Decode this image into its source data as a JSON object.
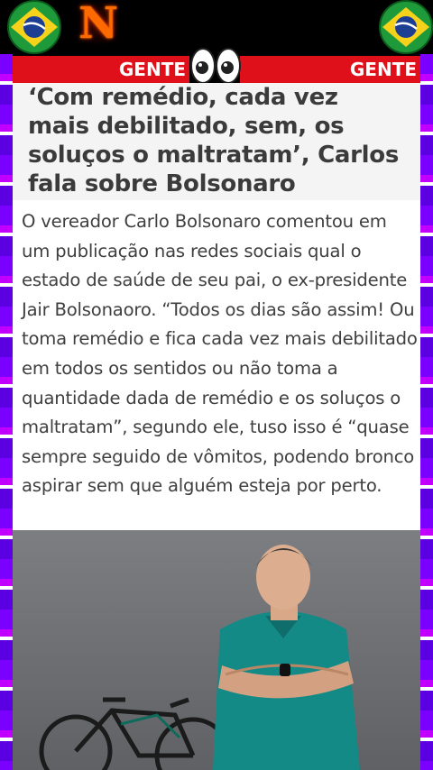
{
  "header": {
    "logo_letter": "N",
    "ticker_left": "GENTE",
    "ticker_right": "GENTE"
  },
  "article": {
    "headline": "‘Com remédio, cada vez mais debilitado, sem, os soluços o maltratam’, Carlos fala sobre Bolsonaro",
    "body": "O vereador Carlo Bolsonaro comentou em um publicação nas redes sociais qual o estado de saúde de seu pai, o ex-presidente Jair Bolsonaoro. “Todos os dias são assim! Ou toma remédio e fica cada vez mais debilitado em todos os sentidos ou não toma a quantidade dada de remédio e os soluços o maltratam”, segundo ele, tuso isso é “quase sempre seguido de vômitos, podendo bronco aspirar sem que alguém esteja por perto."
  },
  "icons": {
    "flag": "brazil-flag-icon",
    "eyes": "eyes-emoji-icon"
  },
  "colors": {
    "ticker": "#e0101a",
    "side_strip": "#7a00ff",
    "headline_bg": "#f4f4f4"
  }
}
